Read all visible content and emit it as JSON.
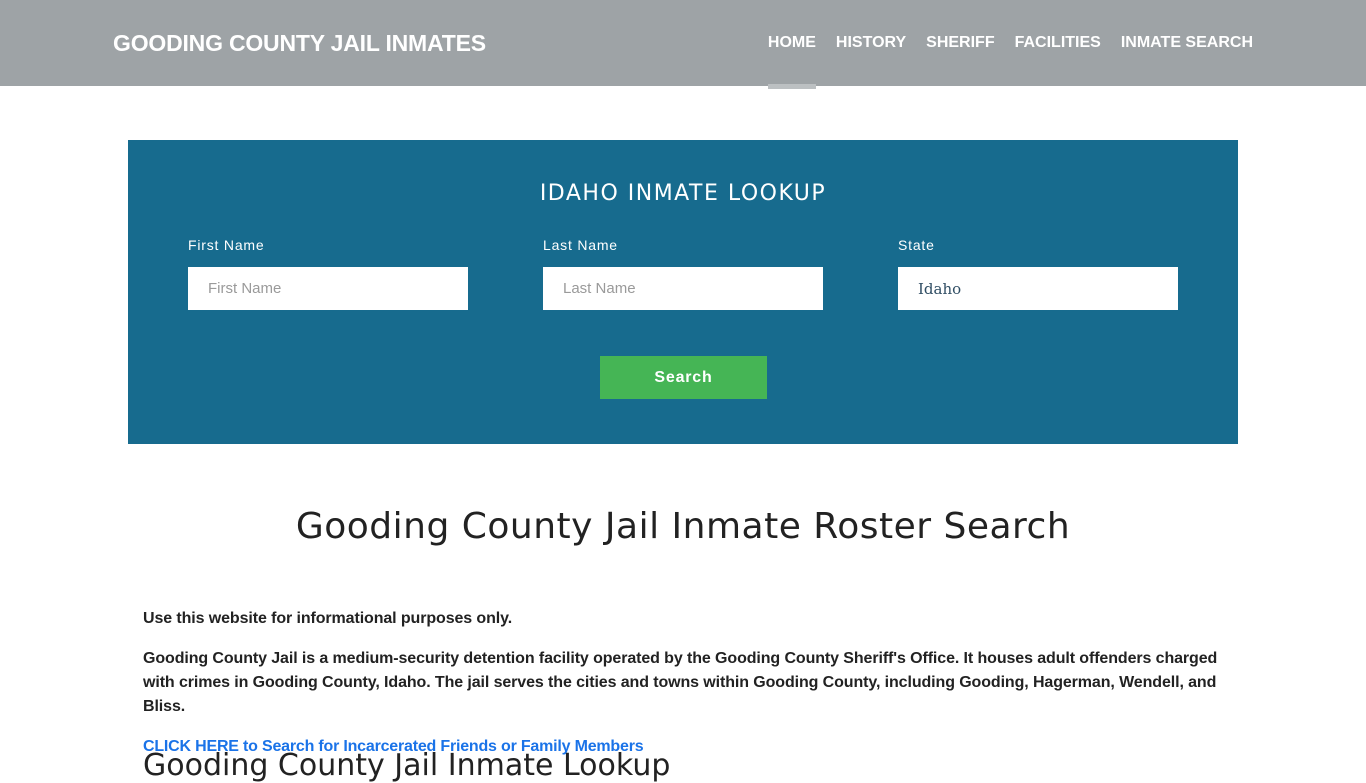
{
  "header": {
    "brand": "GOODING COUNTY JAIL INMATES",
    "nav": [
      {
        "label": "HOME",
        "active": true
      },
      {
        "label": "HISTORY",
        "active": false
      },
      {
        "label": "SHERIFF",
        "active": false
      },
      {
        "label": "FACILITIES",
        "active": false
      },
      {
        "label": "INMATE SEARCH",
        "active": false
      }
    ]
  },
  "lookup": {
    "title": "IDAHO INMATE LOOKUP",
    "first_name": {
      "label": "First Name",
      "placeholder": "First Name",
      "value": ""
    },
    "last_name": {
      "label": "Last Name",
      "placeholder": "Last Name",
      "value": ""
    },
    "state": {
      "label": "State",
      "value": "Idaho"
    },
    "search_label": "Search"
  },
  "main": {
    "heading": "Gooding County Jail Inmate Roster Search",
    "paragraphs": [
      "Use this website for informational purposes only.",
      "Gooding County Jail is a medium-security detention facility operated by the Gooding County Sheriff's Office. It houses adult offenders charged with crimes in Gooding County, Idaho. The jail serves the cities and towns within Gooding County, including Gooding, Hagerman, Wendell, and Bliss."
    ],
    "cta_link": "CLICK HERE to Search for Incarcerated Friends or Family Members",
    "subheading": "Gooding County Jail Inmate Lookup"
  },
  "colors": {
    "header_bg": "#9ea3a6",
    "lookup_bg": "#176b8e",
    "search_button": "#45b555",
    "link": "#1a73e8"
  }
}
